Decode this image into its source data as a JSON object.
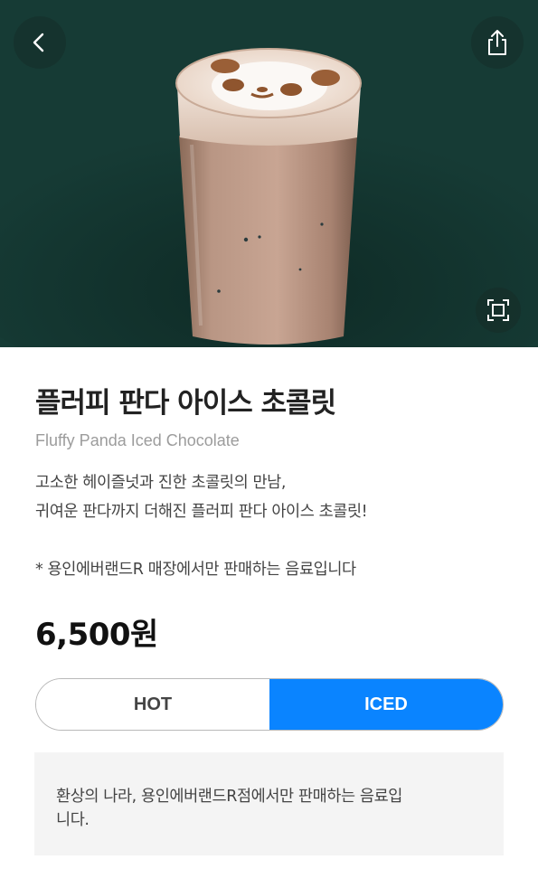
{
  "header": {
    "back_icon": "chevron-left-icon",
    "share_icon": "share-icon",
    "zoom_icon": "fullscreen-icon",
    "hero_bg_color": "#163b35"
  },
  "product": {
    "name_ko": "플러피 판다 아이스 초콜릿",
    "name_en": "Fluffy Panda Iced Chocolate",
    "description_lines": [
      "고소한 헤이즐넛과 진한 초콜릿의 만남,",
      "귀여운 판다까지 더해진 플러피 판다 아이스 초콜릿!"
    ],
    "note": "* 용인에버랜드R 매장에서만 판매하는 음료입니다",
    "price": "6,500원"
  },
  "temperature_toggle": {
    "options": [
      "HOT",
      "ICED"
    ],
    "selected": "ICED",
    "accent_color": "#0a84ff"
  },
  "info_box": {
    "text_lines": [
      "환상의 나라, 용인에버랜드R점에서만 판매하는 음료입",
      "니다."
    ]
  }
}
